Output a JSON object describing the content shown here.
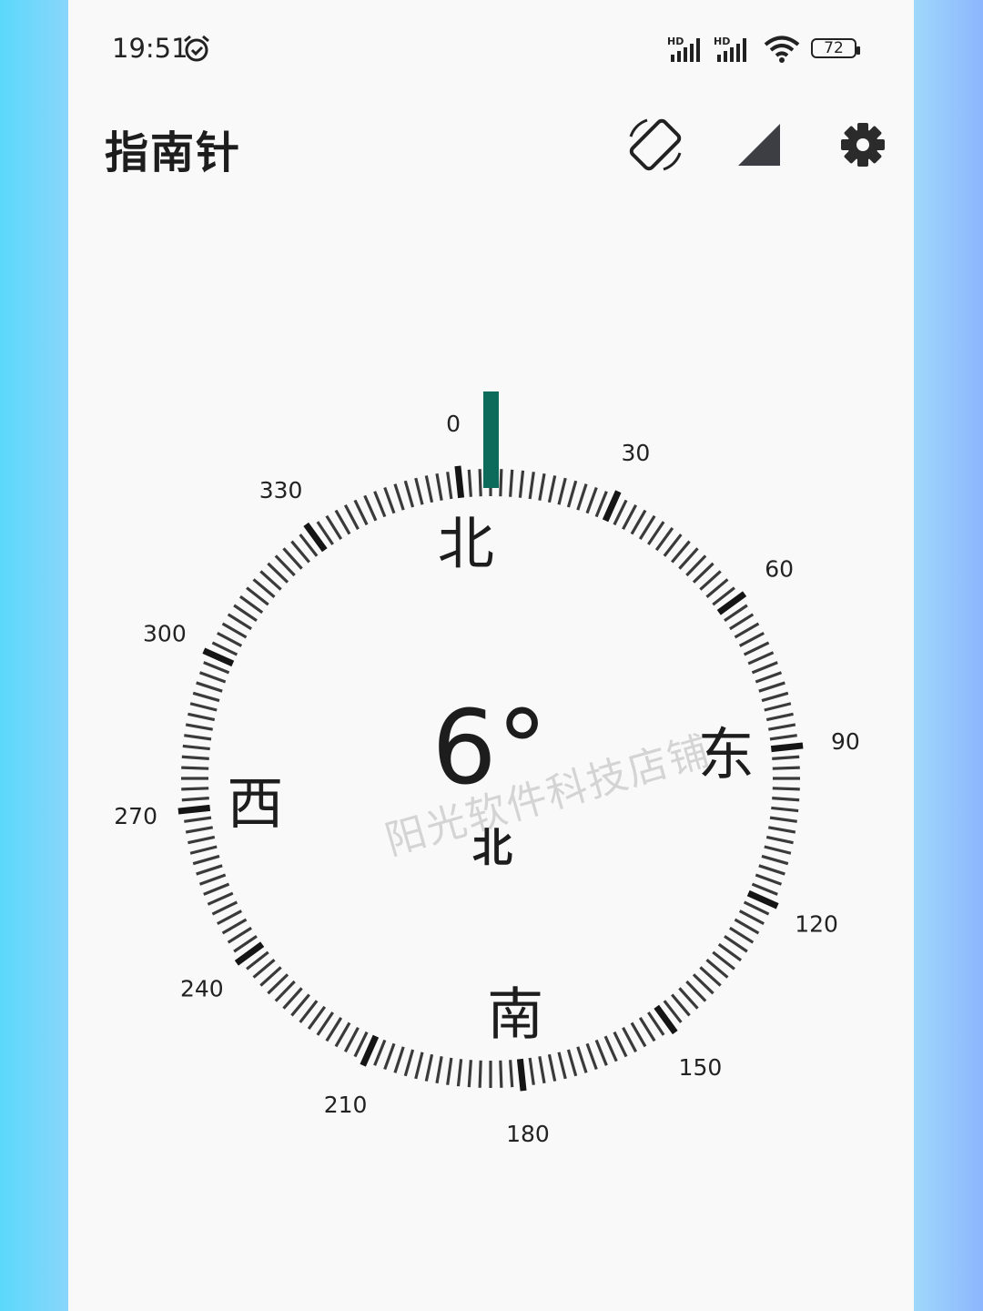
{
  "status_bar": {
    "time": "19:51",
    "alarm_icon": "alarm-clock-icon",
    "signal_label_1": "HD",
    "signal_label_2": "HD",
    "battery": "72"
  },
  "header": {
    "title": "指南针",
    "rotate_icon": "screen-rotate-icon",
    "calibrate_icon": "signal-triangle-icon",
    "settings_icon": "gear-icon"
  },
  "compass": {
    "heading_value": 6,
    "heading_text": "6°",
    "heading_direction": "北",
    "cardinals": {
      "north": "北",
      "east": "东",
      "south": "南",
      "west": "西"
    },
    "degree_labels": [
      "0",
      "30",
      "60",
      "90",
      "120",
      "150",
      "180",
      "210",
      "240",
      "270",
      "300",
      "330"
    ],
    "pointer_color": "#0d6b5c",
    "tick_color": "#3a3a3a"
  },
  "watermark": "阳光软件科技店铺"
}
